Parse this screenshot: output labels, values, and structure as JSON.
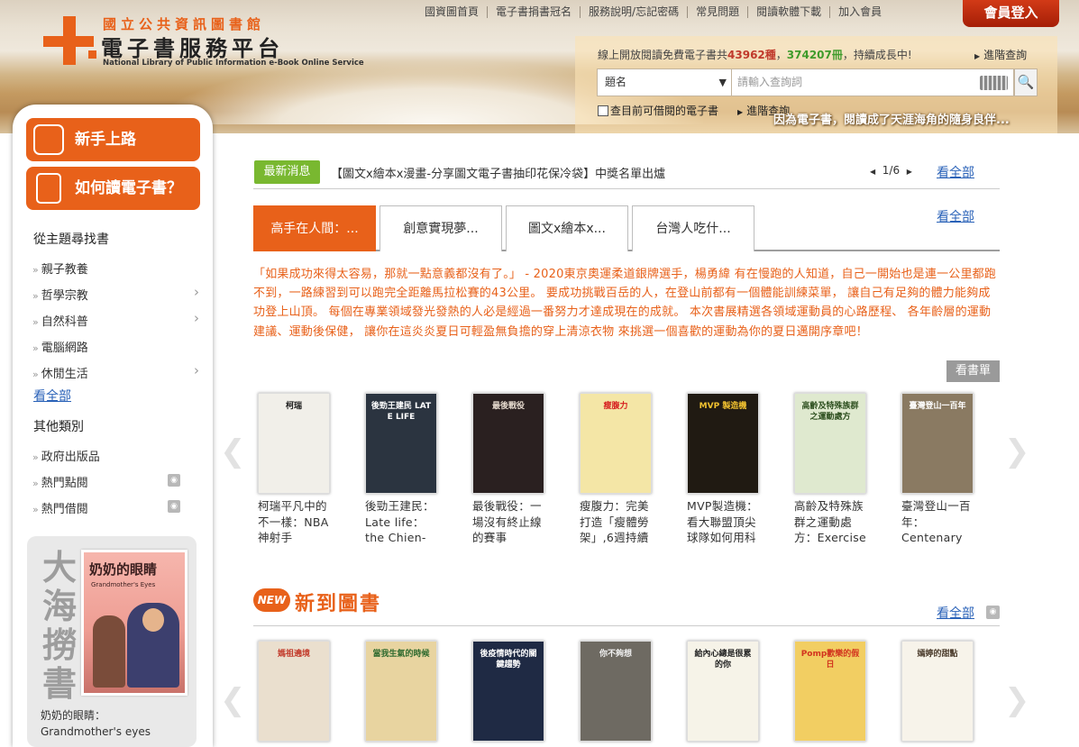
{
  "header": {
    "logo_line1": "國立公共資訊圖書館",
    "logo_line2": "電子書服務平台",
    "logo_en": "National Library of Public Information e-Book Online Service",
    "nav": [
      "國資圖首頁",
      "電子書捐書冠名",
      "服務說明/忘記密碼",
      "常見問題",
      "閱讀軟體下載",
      "加入會員"
    ],
    "login": "會員登入"
  },
  "search": {
    "stats_pre": "線上開放閱讀免費電子書共",
    "stats_kinds": "43962種",
    "stats_sep": "，",
    "stats_copies": "374207冊",
    "stats_post": "，持續成長中!",
    "advanced_label": "進階查詢",
    "field_selected": "題名",
    "placeholder": "請輸入查詢詞",
    "checkbox_label": "查目前可借閱的電子書",
    "advanced_label2": "進階查詢",
    "slogan": "因為電子書，閱讀成了天涯海角的隨身良伴..."
  },
  "sidebar": {
    "btn_new_user": "新手上路",
    "btn_how_to_read": "如何讀電子書？",
    "theme_title": "從主題尋找書",
    "theme_items": [
      "親子教養",
      "哲學宗教",
      "自然科普",
      "電腦網路",
      "休閒生活"
    ],
    "view_all": "看全部",
    "other_title": "其他類別",
    "other_items": [
      "政府出版品",
      "熱門點閱",
      "熱門借閱"
    ],
    "featured_vertical": "大海撈書",
    "featured_cover_title": "奶奶的眼睛",
    "featured_cover_en": "Grandmother's Eyes",
    "featured_caption1": "奶奶的眼睛：",
    "featured_caption2": "Grandmother's eyes"
  },
  "news": {
    "badge": "最新消息",
    "text": "【圖文x繪本x漫畫-分享圖文電子書抽印花保冷袋】中獎名單出爐",
    "page": "1/6",
    "more": "看全部"
  },
  "tabs": {
    "items": [
      "高手在人間：...",
      "創意實現夢...",
      "圖文x繪本x...",
      "台灣人吃什..."
    ],
    "more": "看全部",
    "description": "「如果成功來得太容易，那就一點意義都沒有了。」 - 2020東京奧運柔道銀牌選手，楊勇緯 有在慢跑的人知道，自己一開始也是連一公里都跑不到，一路練習到可以跑完全距離馬拉松賽的43公里。 要成功挑戰百岳的人，在登山前都有一個體能訓練菜單， 讓自己有足夠的體力能夠成功登上山頂。 每個在專業領域發光發熱的人必是經過一番努力才達成現在的成就。 本次書展精選各領域運動員的心路歷程、 各年齡層的運動建議、運動後保健， 讓你在這炎炎夏日可輕盈無負擔的穿上清涼衣物 來挑選一個喜歡的運動為你的夏日邁開序章吧！",
    "view_list": "看書單"
  },
  "featured_books": [
    {
      "cover": "柯瑞",
      "caption": "柯瑞平凡中的不一樣：NBA神射手",
      "bg": "#f1efe9",
      "fg": "#1a1a1a"
    },
    {
      "cover": "後勁王建民 LATE LIFE",
      "caption": "後勁王建民：Late life：the Chien-",
      "bg": "#2b3440",
      "fg": "#ffffff"
    },
    {
      "cover": "最後戰役",
      "caption": "最後戰役：一場沒有終止線的賽事",
      "bg": "#2a2020",
      "fg": "#e4d8cc"
    },
    {
      "cover": "瘦腹力",
      "caption": "瘦腹力：完美打造「瘦體勞架」,6週持續",
      "bg": "#f4e6a6",
      "fg": "#d62020"
    },
    {
      "cover": "MVP 製造機",
      "caption": "MVP製造機：看大聯盟頂尖球隊如何用科",
      "bg": "#201a12",
      "fg": "#f2c230"
    },
    {
      "cover": "高齡及特殊族群之運動處方",
      "caption": "高齡及特殊族群之運動處方：Exercise",
      "bg": "#dfe9cf",
      "fg": "#2e5020"
    },
    {
      "cover": "臺灣登山一百年",
      "caption": "臺灣登山一百年：Centenary",
      "bg": "#8a7a62",
      "fg": "#ffffff"
    }
  ],
  "new_arrivals": {
    "badge": "NEW",
    "title": "新到圖書",
    "more": "看全部",
    "books": [
      {
        "cover": "媽祖遶境",
        "bg": "#eadfce",
        "fg": "#c23a2a"
      },
      {
        "cover": "當我生氣的時候",
        "bg": "#e8d4a0",
        "fg": "#2e6a2e"
      },
      {
        "cover": "後疫情時代的關鍵趨勢",
        "bg": "#1f2a44",
        "fg": "#ffffff"
      },
      {
        "cover": "你不夠想",
        "bg": "#6e6a62",
        "fg": "#f0f0f0"
      },
      {
        "cover": "給內心總是很累的你",
        "bg": "#f6f3e8",
        "fg": "#222222"
      },
      {
        "cover": "Pomp歡樂的假日",
        "bg": "#f2ce62",
        "fg": "#d2341e"
      },
      {
        "cover": "嫣婷的甜點",
        "bg": "#f7f3ea",
        "fg": "#4a3a2a"
      }
    ]
  },
  "icons": {
    "rss": "rss-icon",
    "search": "search-icon",
    "keyboard": "keyboard-icon",
    "dropdown": "chevron-down-icon"
  },
  "colors": {
    "accent": "#e8611a",
    "news_green": "#79b830",
    "link": "#2a62b8",
    "login_red": "#c0300f"
  }
}
